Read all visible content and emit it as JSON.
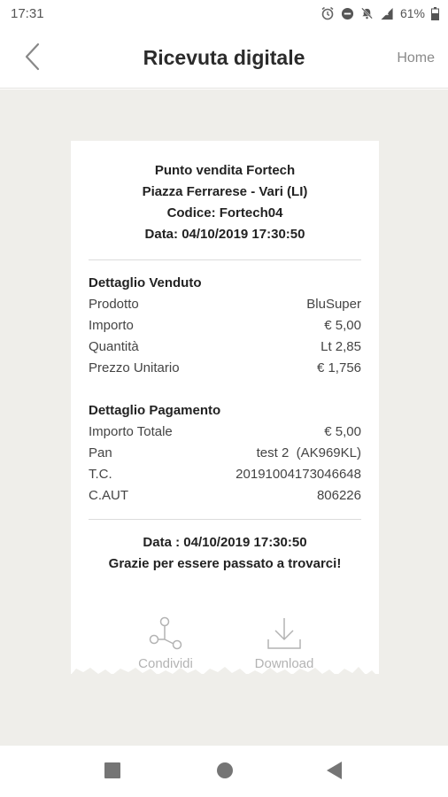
{
  "status_bar": {
    "time": "17:31",
    "battery": "61%"
  },
  "header": {
    "title": "Ricevuta digitale",
    "home_label": "Home"
  },
  "receipt": {
    "store_lines": [
      "Punto vendita Fortech",
      "Piazza Ferrarese - Vari (LI)",
      "Codice: Fortech04",
      "Data: 04/10/2019 17:30:50"
    ],
    "sale_section": {
      "title": "Dettaglio Venduto",
      "rows": [
        {
          "label": "Prodotto",
          "value": "BluSuper"
        },
        {
          "label": "Importo",
          "value": "€ 5,00"
        },
        {
          "label": "Quantità",
          "value": "Lt 2,85"
        },
        {
          "label": "Prezzo Unitario",
          "value": "€ 1,756"
        }
      ]
    },
    "payment_section": {
      "title": "Dettaglio Pagamento",
      "rows": [
        {
          "label": "Importo Totale",
          "value": "€ 5,00"
        },
        {
          "label": "Pan",
          "value": "test 2  (AK969KL)"
        },
        {
          "label": "T.C.",
          "value": "20191004173046648"
        },
        {
          "label": "C.AUT",
          "value": "806226"
        }
      ]
    },
    "footer_lines": [
      "Data : 04/10/2019 17:30:50",
      "Grazie per essere passato a trovarci!"
    ]
  },
  "actions": {
    "share_label": "Condividi",
    "download_label": "Download"
  },
  "colors": {
    "background": "#efeeea",
    "paper": "#ffffff",
    "action_gray": "#b3b3b3"
  },
  "icons": [
    "alarm-icon",
    "dnd-icon",
    "notifications-off-icon",
    "signal-icon",
    "battery-icon",
    "chevron-left-icon",
    "share-icon",
    "download-icon",
    "recents-icon",
    "home-circle-icon",
    "back-triangle-icon"
  ]
}
